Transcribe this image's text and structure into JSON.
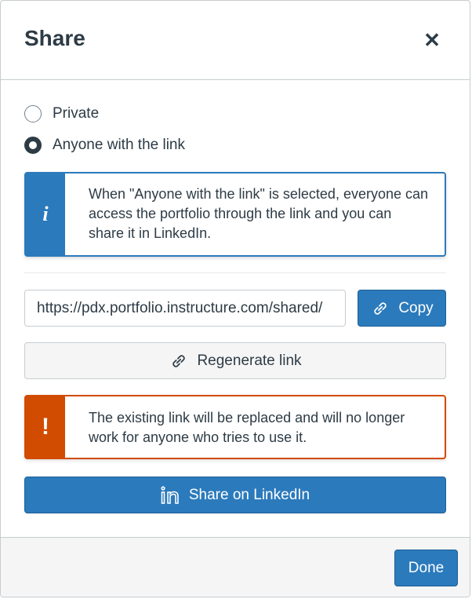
{
  "dialog": {
    "title": "Share",
    "close_icon": "close-icon"
  },
  "visibility": {
    "options": [
      {
        "label": "Private",
        "selected": false
      },
      {
        "label": "Anyone with the link",
        "selected": true
      }
    ]
  },
  "info_alert": {
    "icon": "info-icon",
    "text": "When \"Anyone with the link\" is selected, everyone can access the portfolio through the link and you can share it in LinkedIn."
  },
  "link": {
    "value": "https://pdx.portfolio.instructure.com/shared/",
    "copy_label": "Copy",
    "copy_icon": "link-icon"
  },
  "regenerate": {
    "label": "Regenerate link",
    "icon": "link-icon"
  },
  "warning_alert": {
    "icon": "warning-icon",
    "text": "The existing link will be replaced and will no longer work for anyone who tries to use it."
  },
  "linkedin": {
    "label": "Share on LinkedIn",
    "icon": "linkedin-icon"
  },
  "footer": {
    "done_label": "Done"
  },
  "colors": {
    "primary": "#2b7abc",
    "warning": "#d14b00",
    "text": "#2d3b45"
  }
}
